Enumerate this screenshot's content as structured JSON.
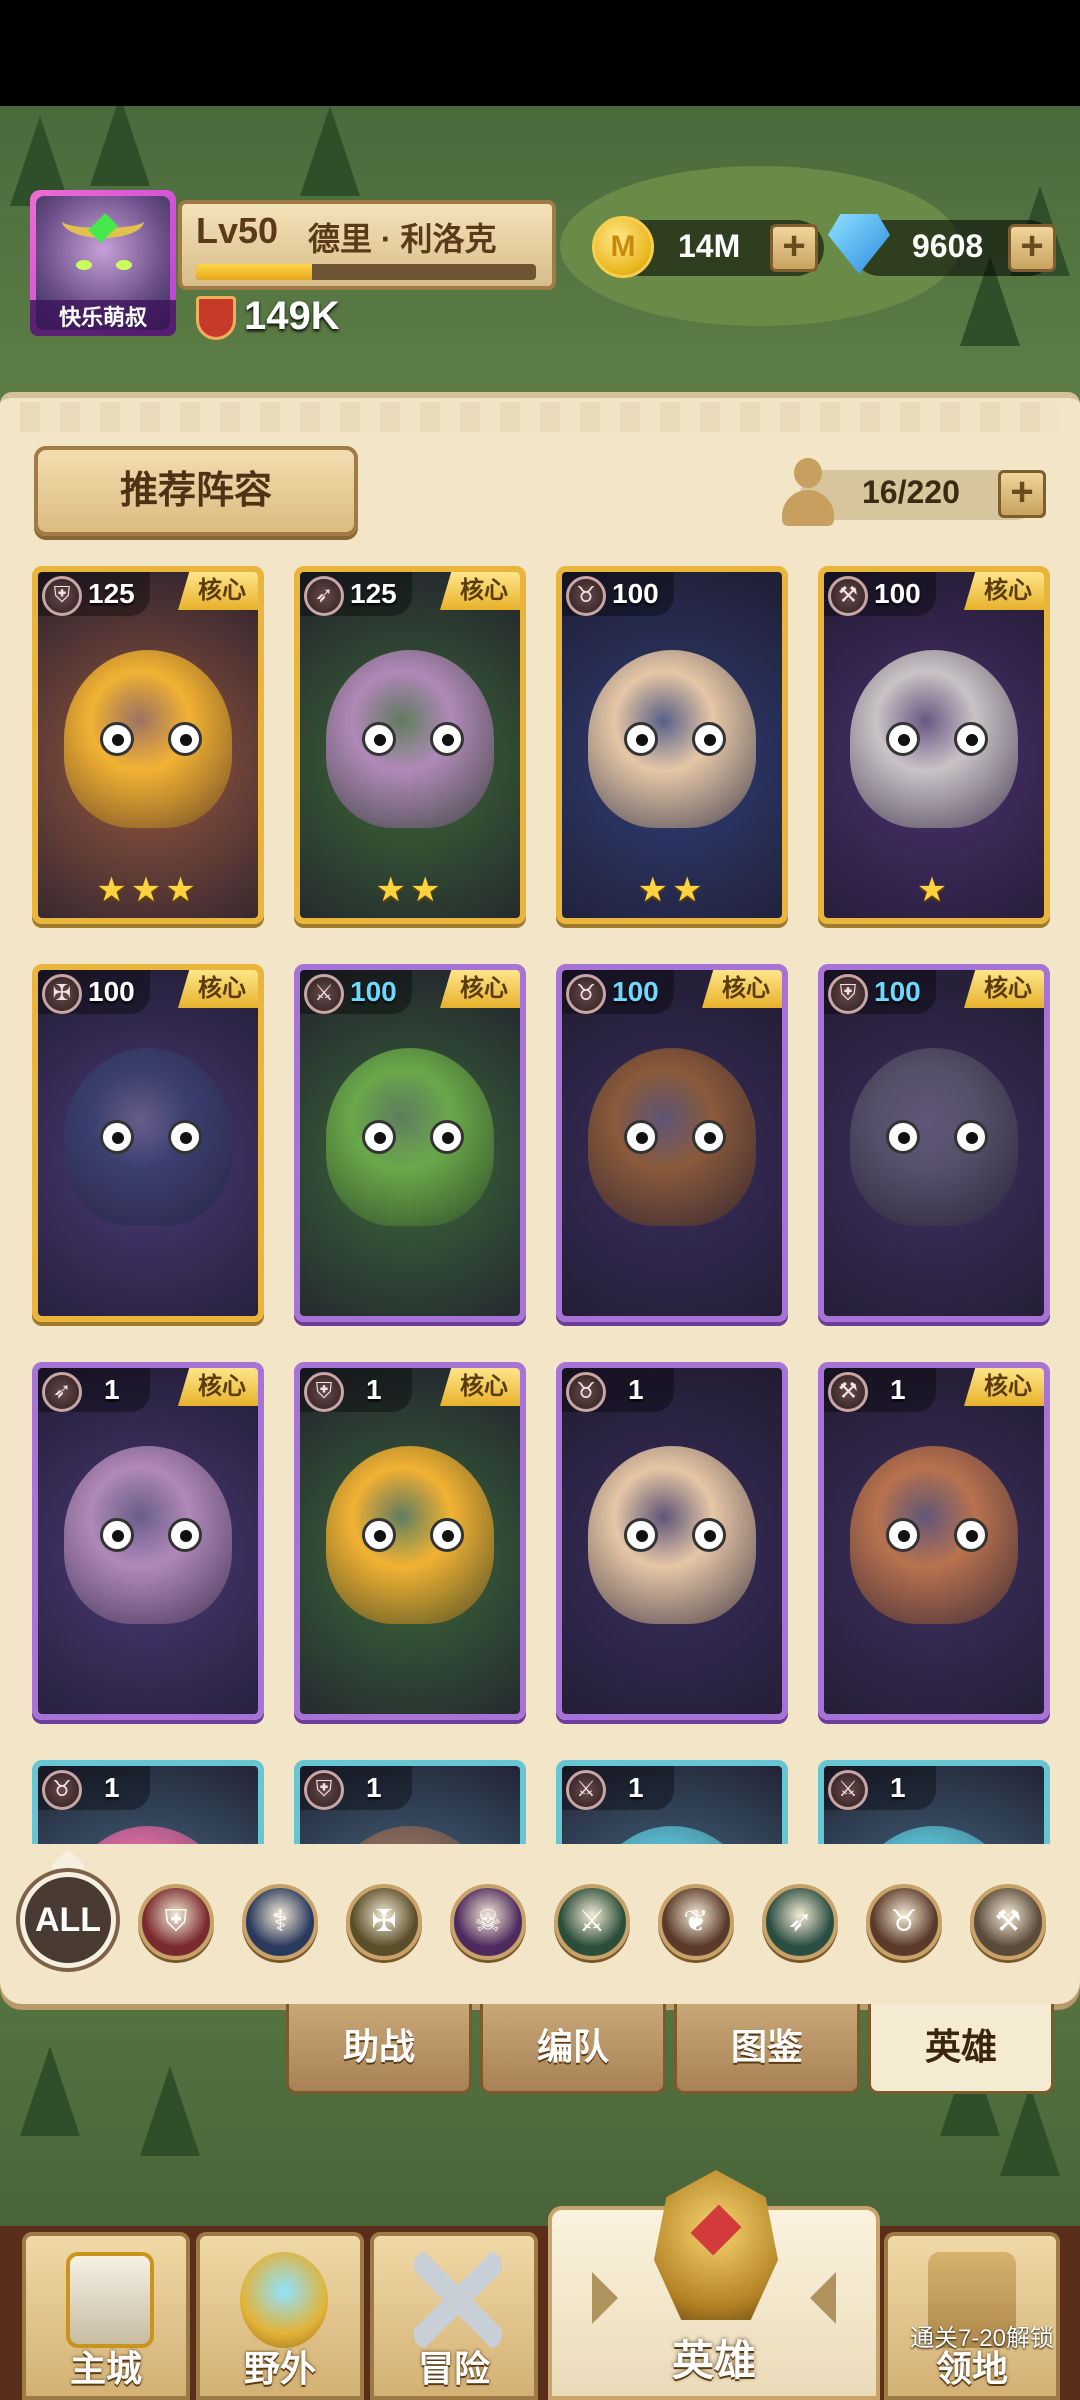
{
  "player": {
    "avatar_label": "快乐萌叔",
    "level": "Lv50",
    "name": "德里 · 利洛克",
    "power": "149K",
    "xp_progress": 0.34
  },
  "currency": {
    "gold": "14M",
    "gems": "9608",
    "plus": "+"
  },
  "panel": {
    "recommend_label": "推荐阵容",
    "capacity": "16/220"
  },
  "hero_cards": [
    {
      "level": "125",
      "role": "shield-icon",
      "core": "核心",
      "stars": "★★★",
      "frame": "gold"
    },
    {
      "level": "125",
      "role": "bow-icon",
      "core": "核心",
      "stars": "★★",
      "frame": "gold"
    },
    {
      "level": "100",
      "role": "beast-icon",
      "core": "",
      "stars": "★★",
      "frame": "gold"
    },
    {
      "level": "100",
      "role": "axe-icon",
      "core": "核心",
      "stars": "★",
      "frame": "gold"
    },
    {
      "level": "100",
      "role": "wings-icon",
      "core": "核心",
      "stars": "",
      "frame": "gold"
    },
    {
      "level": "100",
      "role": "swords-icon",
      "core": "核心",
      "stars": "",
      "frame": "purple"
    },
    {
      "level": "100",
      "role": "beast-icon",
      "core": "核心",
      "stars": "",
      "frame": "purple"
    },
    {
      "level": "100",
      "role": "shield-icon",
      "core": "核心",
      "stars": "",
      "frame": "purple"
    },
    {
      "level": "1",
      "role": "bow-icon",
      "core": "核心",
      "stars": "",
      "frame": "purple"
    },
    {
      "level": "1",
      "role": "shield-icon",
      "core": "核心",
      "stars": "",
      "frame": "purple"
    },
    {
      "level": "1",
      "role": "beast-icon",
      "core": "",
      "stars": "",
      "frame": "purple"
    },
    {
      "level": "1",
      "role": "axe-icon",
      "core": "核心",
      "stars": "",
      "frame": "purple"
    },
    {
      "level": "1",
      "role": "beast-icon",
      "core": "",
      "stars": "",
      "frame": "teal"
    },
    {
      "level": "1",
      "role": "shield-icon",
      "core": "",
      "stars": "",
      "frame": "teal"
    },
    {
      "level": "1",
      "role": "swords-icon",
      "core": "",
      "stars": "",
      "frame": "teal"
    },
    {
      "level": "1",
      "role": "swords-icon",
      "core": "",
      "stars": "",
      "frame": "teal"
    }
  ],
  "filters": {
    "all_label": "ALL",
    "items": [
      "shield-icon",
      "staff-icon",
      "wings-icon",
      "skull-icon",
      "swords-icon",
      "paw-icon",
      "bow-icon",
      "beast-icon",
      "hammer-icon"
    ]
  },
  "subtabs": [
    "助战",
    "编队",
    "图鉴",
    "英雄"
  ],
  "nav": {
    "main_city": "主城",
    "wild": "野外",
    "adventure": "冒险",
    "hero": "英雄",
    "territory": "领地",
    "unlock_hint": "通关7-20解锁"
  },
  "colors": {
    "panel_bg": "#f2e5c8",
    "gold_frame": "#e9b53a",
    "purple_frame": "#a873d6",
    "teal_frame": "#67c6d3"
  }
}
